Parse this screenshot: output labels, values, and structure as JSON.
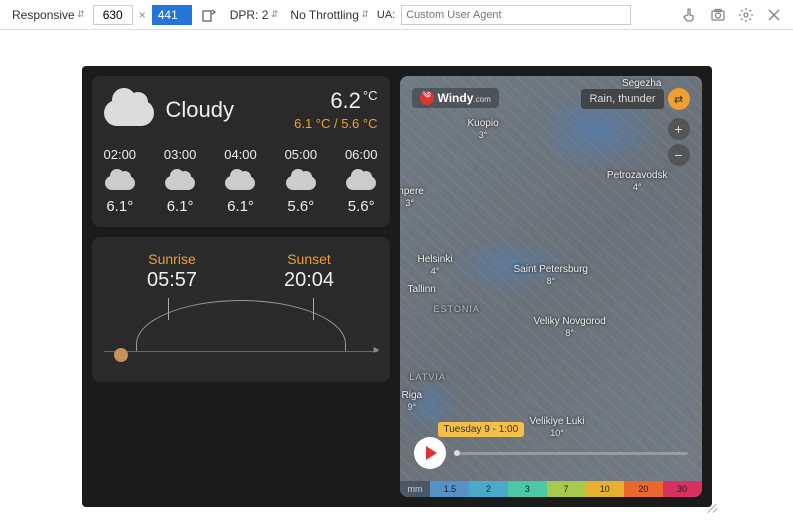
{
  "devtools": {
    "mode": "Responsive",
    "width": "630",
    "height": "441",
    "dpr": "DPR: 2",
    "throttling": "No Throttling",
    "ua_label": "UA:",
    "ua_placeholder": "Custom User Agent"
  },
  "weather": {
    "condition": "Cloudy",
    "temp": "6.2",
    "temp_unit": "°C",
    "range": "6.1 °C / 5.6 °C",
    "hourly": [
      {
        "time": "02:00",
        "temp": "6.1°"
      },
      {
        "time": "03:00",
        "temp": "6.1°"
      },
      {
        "time": "04:00",
        "temp": "6.1°"
      },
      {
        "time": "05:00",
        "temp": "5.6°"
      },
      {
        "time": "06:00",
        "temp": "5.6°"
      }
    ],
    "sunrise_label": "Sunrise",
    "sunrise_time": "05:57",
    "sunset_label": "Sunset",
    "sunset_time": "20:04"
  },
  "map": {
    "brand": "Windy",
    "brand_sub": ".com",
    "layer": "Rain, thunder",
    "time_label": "Tuesday 9 - 1:00",
    "cities": {
      "segezha": "Segezha",
      "kuopio": "Kuopio",
      "kuopio_t": "3°",
      "petrozavodsk": "Petrozavodsk",
      "petrozavodsk_t": "4°",
      "impere": "mpere",
      "impere_t": "3°",
      "helsinki": "Helsinki",
      "helsinki_t": "4°",
      "spb": "Saint Petersburg",
      "spb_t": "8°",
      "tallinn": "Tallinn",
      "novgorod": "Veliky Novgorod",
      "novgorod_t": "8°",
      "riga": "Riga",
      "riga_t": "9°",
      "luki": "Velikiye Luki",
      "luki_t": "10°"
    },
    "countries": {
      "estonia": "ESTONIA",
      "latvia": "LATVIA"
    },
    "scale": {
      "unit": "mm",
      "v1": "1.5",
      "v2": "2",
      "v3": "3",
      "v4": "7",
      "v5": "10",
      "v6": "20",
      "v7": "30"
    }
  }
}
